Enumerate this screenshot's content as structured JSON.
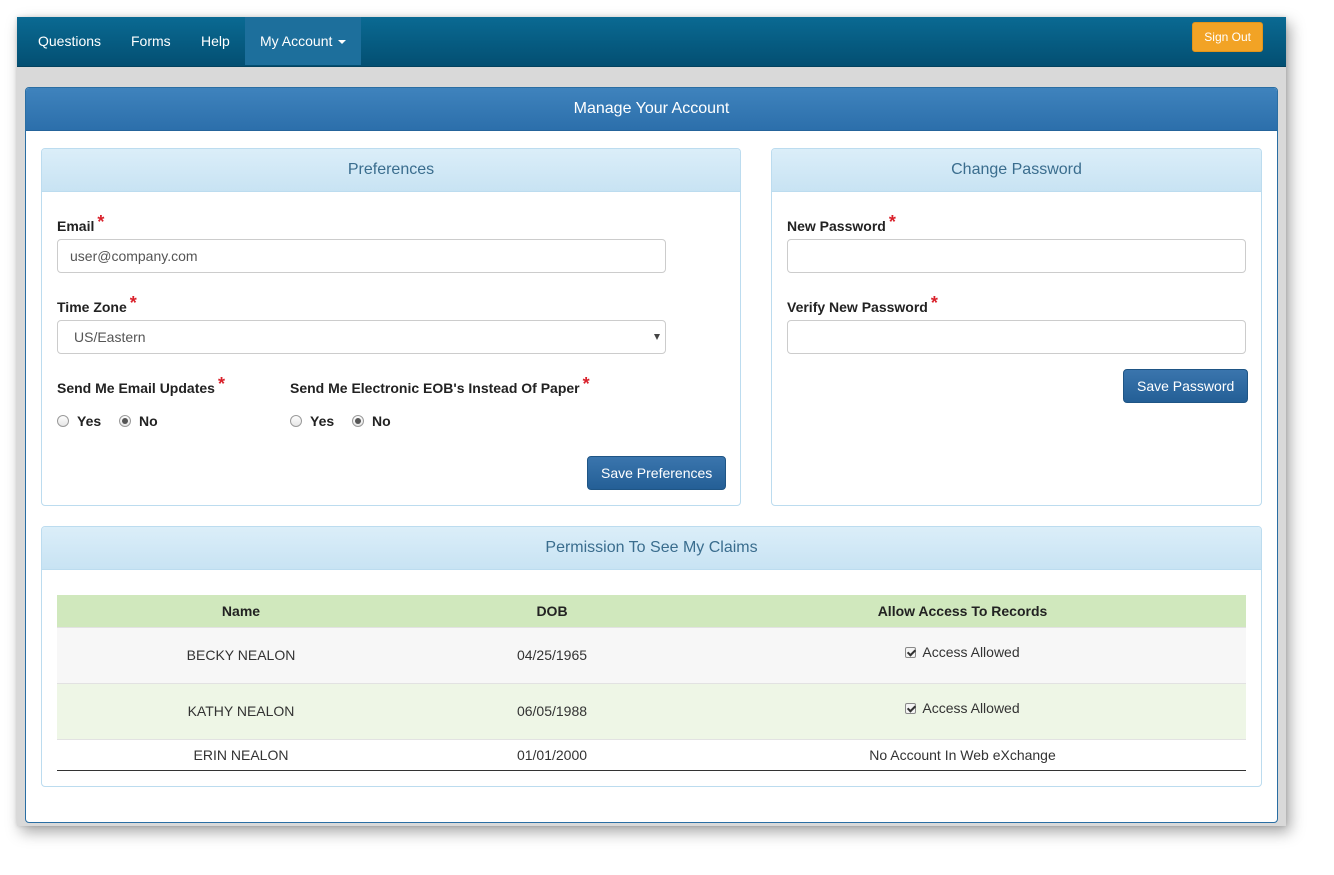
{
  "nav": {
    "items": [
      {
        "label": "Questions"
      },
      {
        "label": "Forms"
      },
      {
        "label": "Help"
      },
      {
        "label": "My Account"
      }
    ],
    "signout_label": "Sign Out"
  },
  "main": {
    "title": "Manage Your Account"
  },
  "preferences": {
    "title": "Preferences",
    "email_label": "Email",
    "email_value": "user@company.com",
    "timezone_label": "Time Zone",
    "timezone_value": "US/Eastern",
    "email_updates_label": "Send Me Email Updates",
    "eob_label": "Send Me Electronic EOB's Instead Of Paper",
    "yes_label": "Yes",
    "no_label": "No",
    "email_updates_selected": "No",
    "eob_selected": "No",
    "save_label": "Save Preferences",
    "required_mark": "*"
  },
  "password": {
    "title": "Change Password",
    "new_label": "New Password",
    "verify_label": "Verify New Password",
    "save_label": "Save Password",
    "required_mark": "*"
  },
  "claims": {
    "title": "Permission To See My Claims",
    "columns": [
      "Name",
      "DOB",
      "Allow Access To Records"
    ],
    "rows": [
      {
        "name": "BECKY NEALON",
        "dob": "04/25/1965",
        "access": "Access Allowed",
        "checked": true
      },
      {
        "name": "KATHY NEALON",
        "dob": "06/05/1988",
        "access": "Access Allowed",
        "checked": true
      },
      {
        "name": "ERIN NEALON",
        "dob": "01/01/2000",
        "access": "No Account In Web eXchange",
        "checked": false
      }
    ]
  },
  "colors": {
    "navbar": "#034f72",
    "main_heading": "#2c6fab",
    "subpanel_heading": "#c8e3f3",
    "signout": "#f2a325",
    "table_header": "#d0e8bd",
    "required": "#d9202a"
  }
}
